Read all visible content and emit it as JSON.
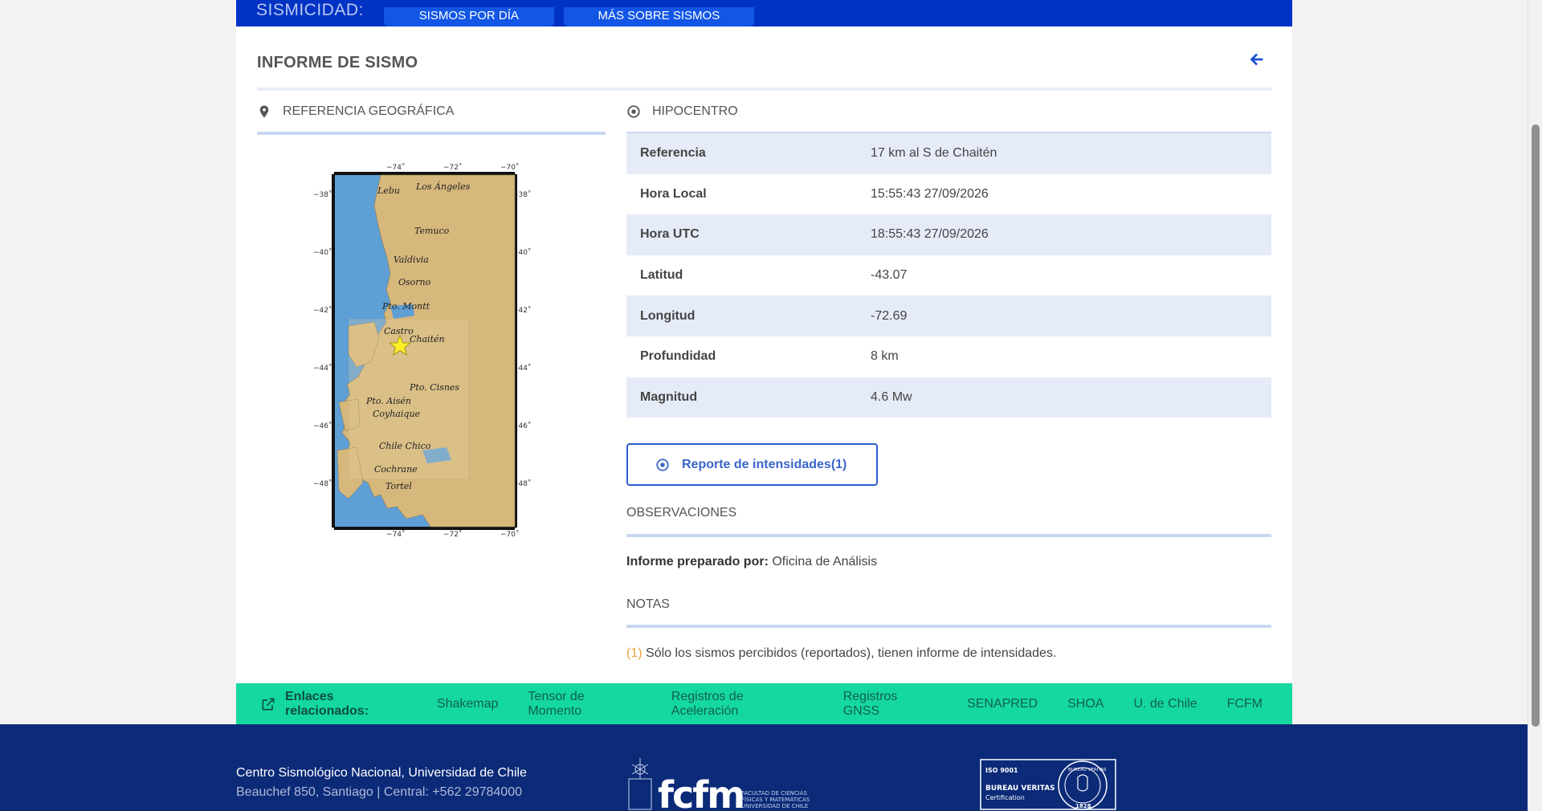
{
  "nav": {
    "label": "SISMICIDAD:",
    "buttons": [
      "SISMOS POR DÍA",
      "MÁS SOBRE SISMOS"
    ]
  },
  "report": {
    "title": "INFORME DE SISMO",
    "geo_heading": "REFERENCIA GEOGRÁFICA",
    "hypo_heading": "HIPOCENTRO",
    "rows": [
      {
        "k": "Referencia",
        "v": "17 km al S de Chaitén"
      },
      {
        "k": "Hora Local",
        "v": "15:55:43 27/09/2026"
      },
      {
        "k": "Hora UTC",
        "v": "18:55:43 27/09/2026"
      },
      {
        "k": "Latitud",
        "v": "-43.07"
      },
      {
        "k": "Longitud",
        "v": "-72.69"
      },
      {
        "k": "Profundidad",
        "v": "8 km"
      },
      {
        "k": "Magnitud",
        "v": "4.6 Mw"
      }
    ],
    "intensity_button": "Reporte de intensidades(1)",
    "obs_heading": "OBSERVACIONES",
    "prepared_label": "Informe preparado por:",
    "prepared_value": "Oficina de Análisis",
    "notes_heading": "NOTAS",
    "note_num": "(1)",
    "note_text": "Sólo los sismos percibidos (reportados), tienen informe de intensidades."
  },
  "map": {
    "top_ticks": [
      "−74˚",
      "−72˚",
      "−70˚"
    ],
    "side_ticks": [
      "−38˚",
      "−40˚",
      "−42˚",
      "−44˚",
      "−46˚",
      "−48˚"
    ],
    "places": [
      "Lebu",
      "Los Ángeles",
      "Temuco",
      "Valdivia",
      "Osorno",
      "Pto. Montt",
      "Castro",
      "Chaitén",
      "Pto. Cisnes",
      "Pto. Aisén",
      "Coyhaique",
      "Chile Chico",
      "Cochrane",
      "Tortel"
    ],
    "colors": {
      "sea": "#5e9fd6",
      "land": "#d6b77c",
      "epicenter": "#ffef2a"
    }
  },
  "links": {
    "label": "Enlaces relacionados:",
    "items": [
      "Shakemap",
      "Tensor de Momento",
      "Registros de Aceleración",
      "Registros GNSS",
      "SENAPRED",
      "SHOA",
      "U. de Chile",
      "FCFM"
    ]
  },
  "footer": {
    "institution": "Centro Sismológico Nacional, Universidad de Chile",
    "address": "Beauchef 850, Santiago | Central: +562 29784000",
    "fcfm_logo": "fcfm",
    "fcfm_caption": [
      "FACULTAD DE CIENCIAS",
      "FÍSICAS Y MATEMÁTICAS",
      "UNIVERSIDAD DE CHILE"
    ],
    "iso_lines": [
      "ISO 9001",
      "BUREAU VERITAS",
      "Certification"
    ],
    "iso_seal_text": [
      "BUREAU VERITAS",
      "1828"
    ]
  }
}
